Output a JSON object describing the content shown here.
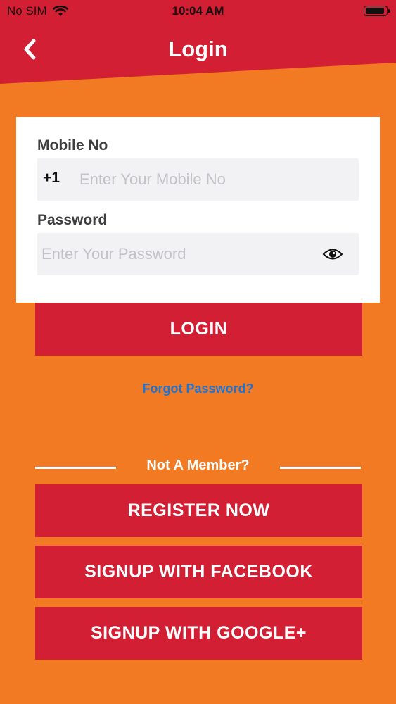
{
  "status_bar": {
    "carrier": "No SIM",
    "time": "10:04 AM"
  },
  "header": {
    "title": "Login"
  },
  "form": {
    "mobile_label": "Mobile No",
    "country_code": "+1",
    "mobile_placeholder": "Enter Your Mobile No",
    "password_label": "Password",
    "password_placeholder": "Enter Your Password"
  },
  "actions": {
    "login_label": "LOGIN",
    "forgot_password": "Forgot Password?",
    "not_member": "Not A Member?",
    "register_label": "REGISTER NOW",
    "facebook_label": "SIGNUP WITH FACEBOOK",
    "google_label": "SIGNUP WITH GOOGLE+"
  },
  "icons": {
    "back": "chevron-left-icon",
    "password_toggle": "eye-icon",
    "wifi": "wifi-icon",
    "battery": "battery-icon"
  },
  "colors": {
    "background": "#F27A22",
    "header": "#D21F33",
    "button": "#D21F33",
    "link": "#1E74D2",
    "field": "#F2F2F4"
  }
}
